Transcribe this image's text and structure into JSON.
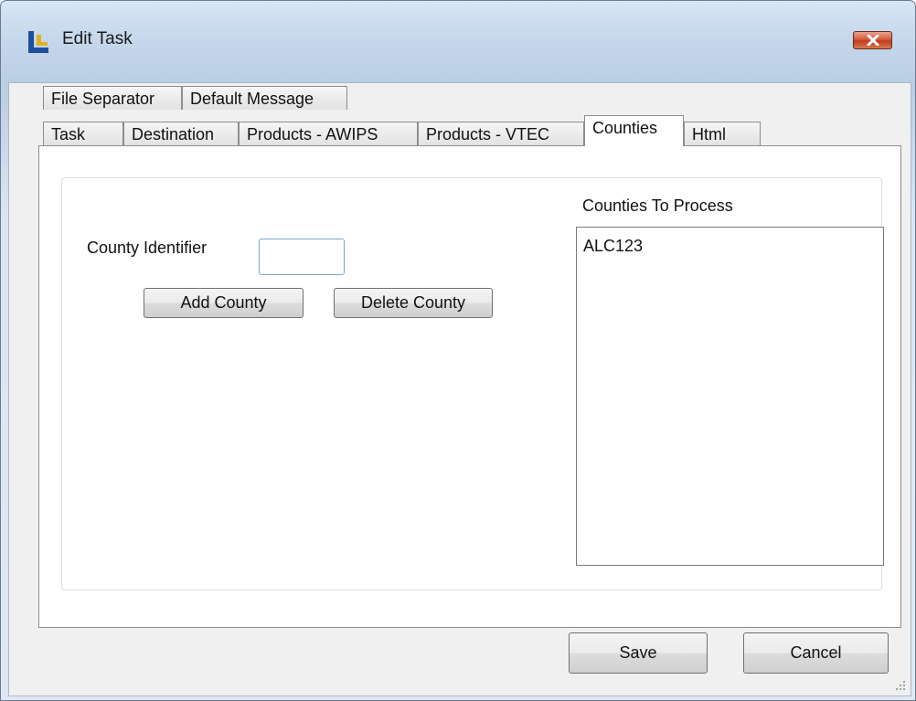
{
  "window": {
    "title": "Edit Task"
  },
  "icons": {
    "app": "app-logo-icon",
    "close": "close-icon",
    "resize": "resize-grip-icon"
  },
  "tabs": {
    "row1": [
      "File Separator",
      "Default Message"
    ],
    "row2": [
      "Task",
      "Destination",
      "Products - AWIPS",
      "Products - VTEC",
      "Counties",
      "Html"
    ],
    "active": "Counties"
  },
  "counties": {
    "identifier_label": "County Identifier",
    "identifier_value": "",
    "add_label": "Add County",
    "delete_label": "Delete County",
    "list_label": "Counties To Process",
    "items": [
      "ALC123"
    ]
  },
  "footer": {
    "save_label": "Save",
    "cancel_label": "Cancel"
  },
  "colors": {
    "close_button": "#c8482a",
    "input_border": "#7ea6d0"
  }
}
